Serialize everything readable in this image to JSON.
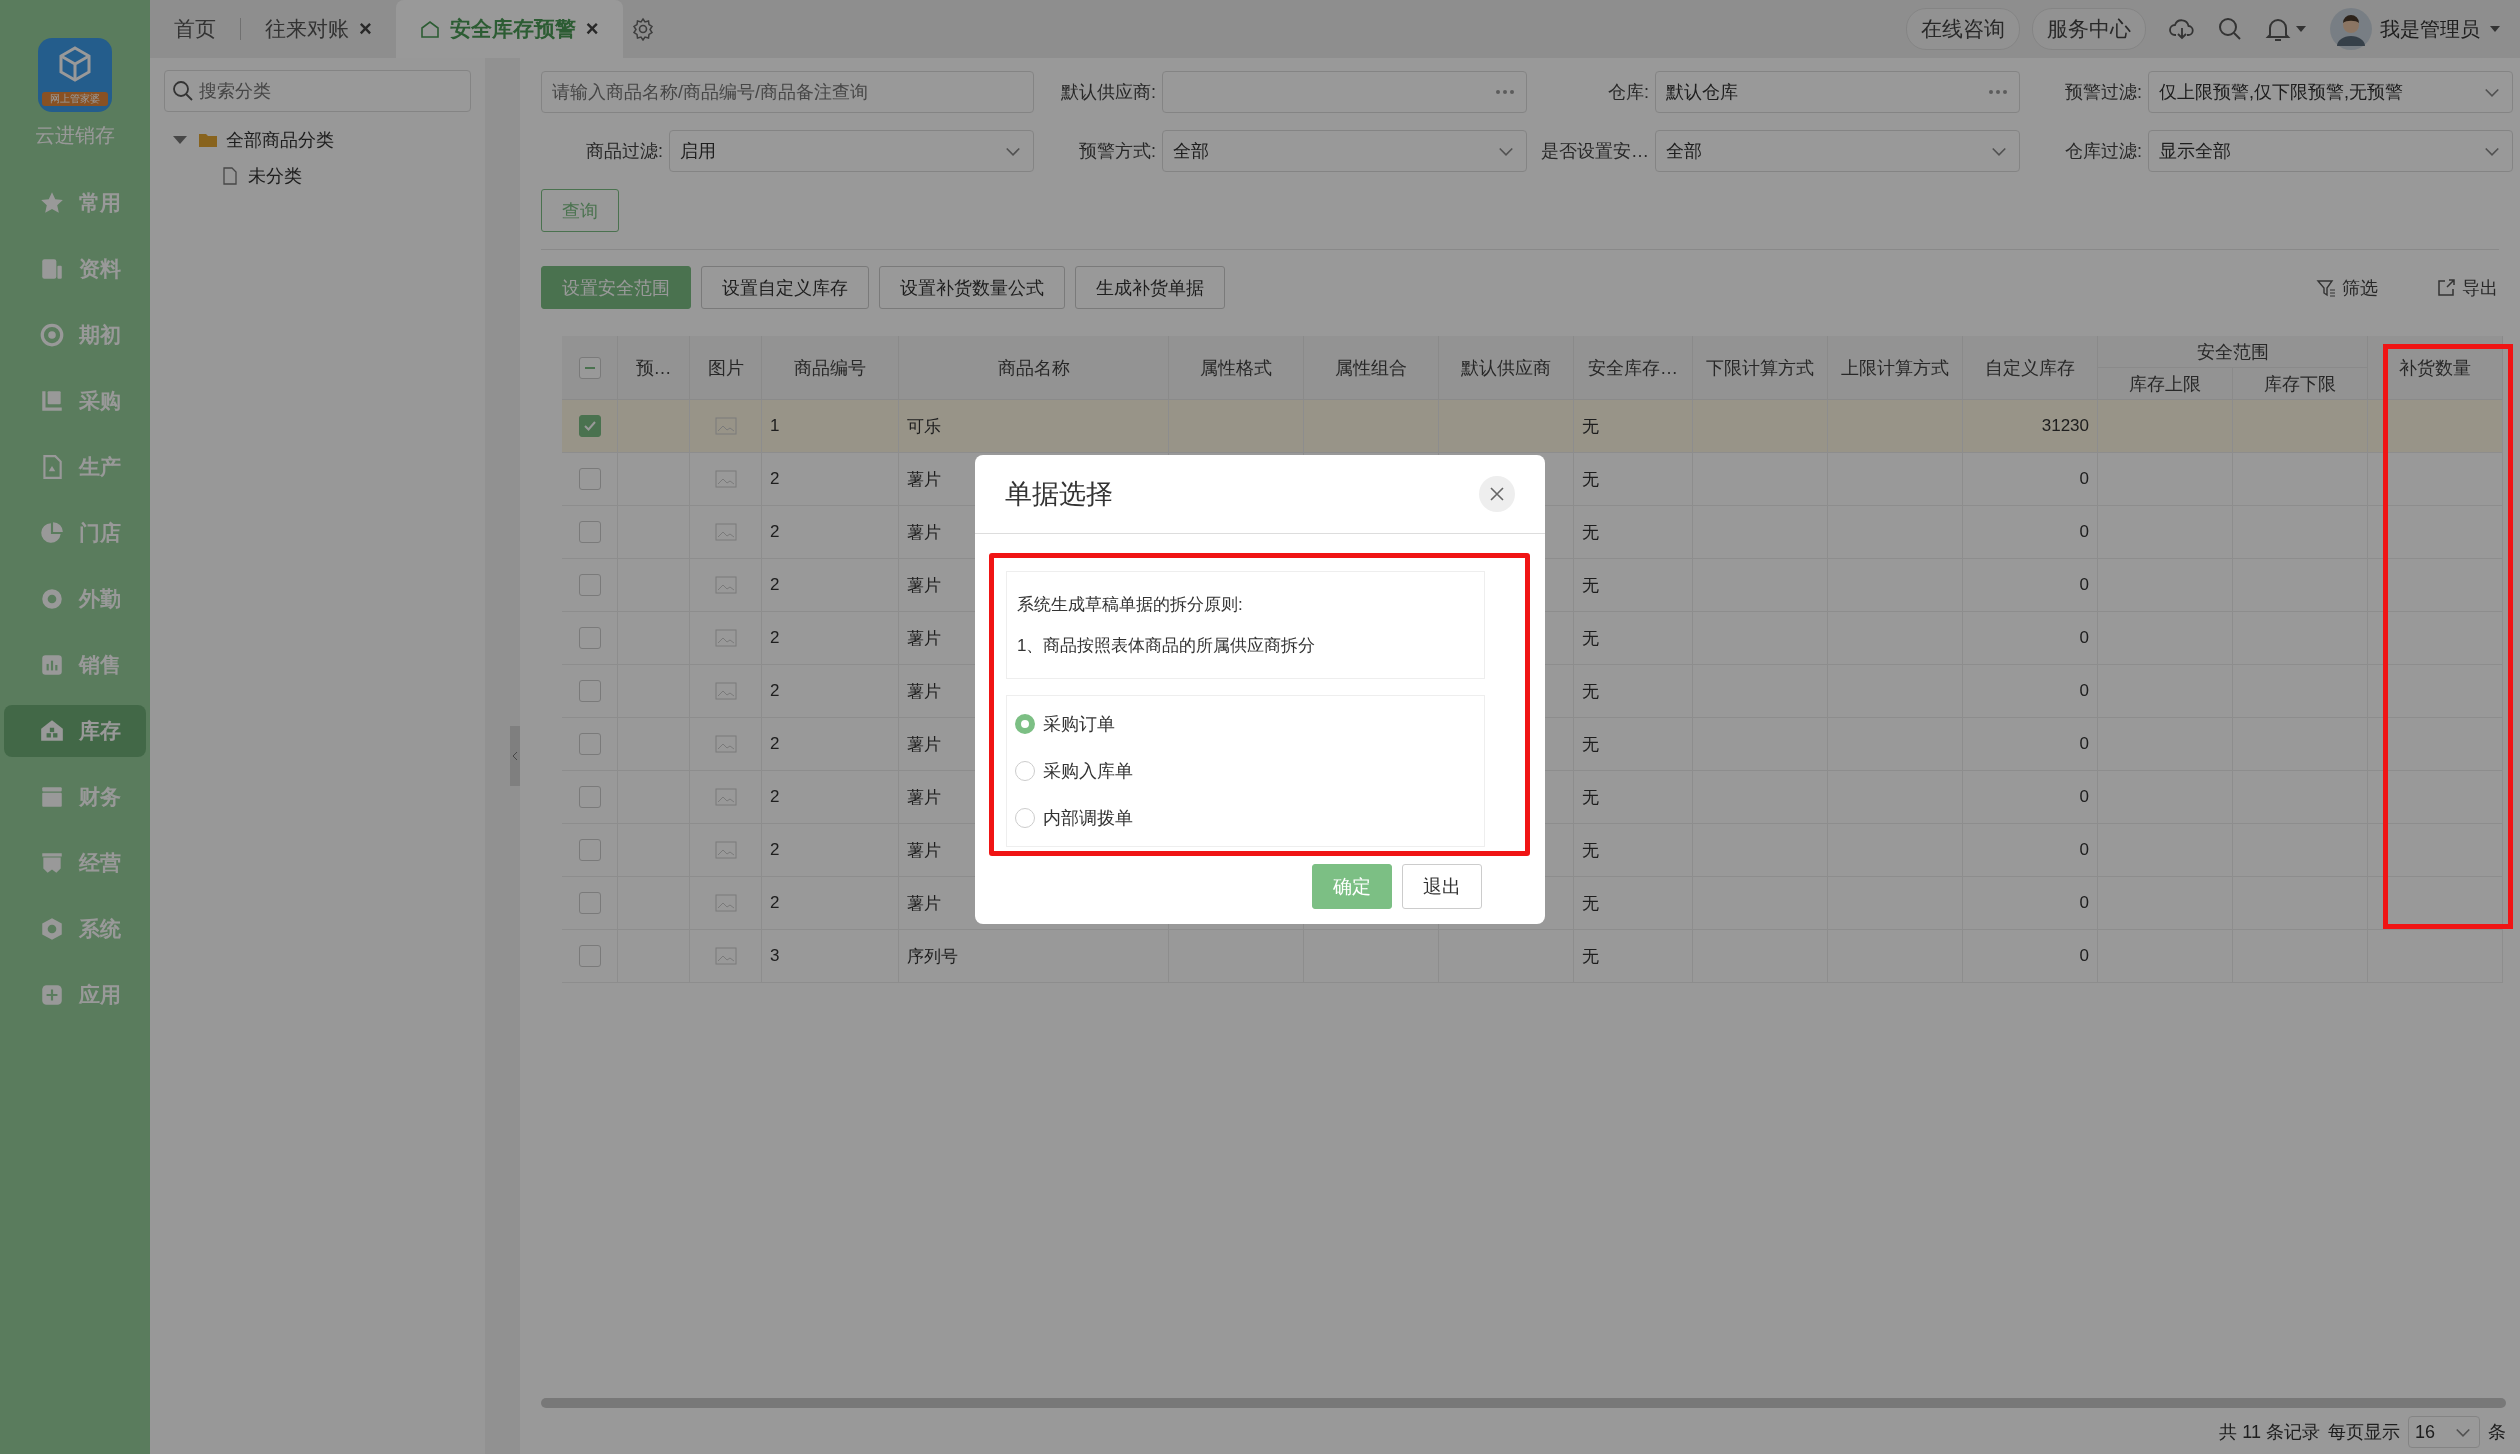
{
  "sidebar": {
    "logo_badge": "网上管家婆",
    "app_name": "云进销存",
    "items": [
      {
        "label": "常用",
        "selected": false
      },
      {
        "label": "资料",
        "selected": false
      },
      {
        "label": "期初",
        "selected": false
      },
      {
        "label": "采购",
        "selected": false
      },
      {
        "label": "生产",
        "selected": false
      },
      {
        "label": "门店",
        "selected": false
      },
      {
        "label": "外勤",
        "selected": false
      },
      {
        "label": "销售",
        "selected": false
      },
      {
        "label": "库存",
        "selected": true
      },
      {
        "label": "财务",
        "selected": false
      },
      {
        "label": "经营",
        "selected": false
      },
      {
        "label": "系统",
        "selected": false
      },
      {
        "label": "应用",
        "selected": false
      }
    ]
  },
  "tabs": [
    {
      "label": "首页",
      "selected": false
    },
    {
      "label": "往来对账",
      "selected": false,
      "close": "×"
    },
    {
      "label": "安全库存预警",
      "selected": true,
      "close": "×"
    }
  ],
  "header_actions": [
    "在线咨询",
    "服务中心"
  ],
  "user": {
    "name": "我是管理员"
  },
  "category_panel": {
    "search": {
      "placeholder": "搜索分类"
    },
    "tree": [
      {
        "label": "全部商品分类",
        "expanded": true,
        "children": [
          {
            "label": "未分类"
          }
        ]
      }
    ]
  },
  "filters": {
    "search": {
      "placeholder": "请输入商品名称/商品编号/商品备注查询"
    },
    "fields": [
      {
        "label": "默认供应商:",
        "kind": "picker"
      },
      {
        "label": "仓库:",
        "kind": "picker",
        "value": "默认仓库"
      },
      {
        "label": "预警过滤:",
        "kind": "select",
        "value": "仅上限预警,仅下限预警,无预警"
      },
      {
        "label": "商品过滤:",
        "kind": "select",
        "value": "启用"
      },
      {
        "label": "预警方式:",
        "kind": "select",
        "value": "全部"
      },
      {
        "label": "是否设置安…",
        "kind": "select",
        "value": "全部"
      },
      {
        "label": "仓库过滤:",
        "kind": "select",
        "value": "显示全部"
      }
    ]
  },
  "query_button": "查询",
  "toolbar": {
    "buttons": [
      {
        "label": "设置安全范围",
        "primary": true
      },
      {
        "label": "设置自定义库存",
        "primary": false
      },
      {
        "label": "设置补货数量公式",
        "primary": false
      },
      {
        "label": "生成补货单据",
        "primary": false
      }
    ],
    "tools": [
      "筛选",
      "导出"
    ]
  },
  "table": {
    "header_checkbox_indeterminate": true,
    "columns": [
      "预…",
      "图片",
      "商品编号",
      "商品名称",
      "属性格式",
      "属性组合",
      "默认供应商",
      "安全库存…",
      "下限计算方式",
      "上限计算方式",
      "自定义库存"
    ],
    "group_header": {
      "label": "安全范围",
      "columns": [
        "库存上限",
        "库存下限"
      ]
    },
    "last_column": "补货数量",
    "rows": [
      {
        "selected": true,
        "checked": true,
        "code": "1",
        "name": "可乐",
        "safety_stock": "无",
        "custom_stock": "31230"
      },
      {
        "selected": false,
        "checked": false,
        "code": "2",
        "name": "薯片",
        "safety_stock": "无",
        "custom_stock": "0"
      },
      {
        "selected": false,
        "checked": false,
        "code": "2",
        "name": "薯片",
        "safety_stock": "无",
        "custom_stock": "0"
      },
      {
        "selected": false,
        "checked": false,
        "code": "2",
        "name": "薯片",
        "safety_stock": "无",
        "custom_stock": "0"
      },
      {
        "selected": false,
        "checked": false,
        "code": "2",
        "name": "薯片",
        "safety_stock": "无",
        "custom_stock": "0"
      },
      {
        "selected": false,
        "checked": false,
        "code": "2",
        "name": "薯片",
        "safety_stock": "无",
        "custom_stock": "0"
      },
      {
        "selected": false,
        "checked": false,
        "code": "2",
        "name": "薯片",
        "safety_stock": "无",
        "custom_stock": "0"
      },
      {
        "selected": false,
        "checked": false,
        "code": "2",
        "name": "薯片",
        "safety_stock": "无",
        "custom_stock": "0"
      },
      {
        "selected": false,
        "checked": false,
        "code": "2",
        "name": "薯片",
        "safety_stock": "无",
        "custom_stock": "0"
      },
      {
        "selected": false,
        "checked": false,
        "code": "2",
        "name": "薯片",
        "safety_stock": "无",
        "custom_stock": "0"
      },
      {
        "selected": false,
        "checked": false,
        "code": "3",
        "name": "序列号",
        "safety_stock": "无",
        "custom_stock": "0"
      }
    ]
  },
  "pagination": {
    "total": "共 11 条记录",
    "per_page_label": "每页显示",
    "per_page": "16",
    "unit": "条"
  },
  "dialog": {
    "title": "单据选择",
    "notes": [
      "系统生成草稿单据的拆分原则:",
      "1、商品按照表体商品的所属供应商拆分"
    ],
    "options": [
      {
        "label": "采购订单",
        "selected": true
      },
      {
        "label": "采购入库单",
        "selected": false
      },
      {
        "label": "内部调拨单",
        "selected": false
      }
    ],
    "buttons": [
      {
        "label": "确定",
        "primary": true
      },
      {
        "label": "退出",
        "primary": false
      }
    ]
  }
}
